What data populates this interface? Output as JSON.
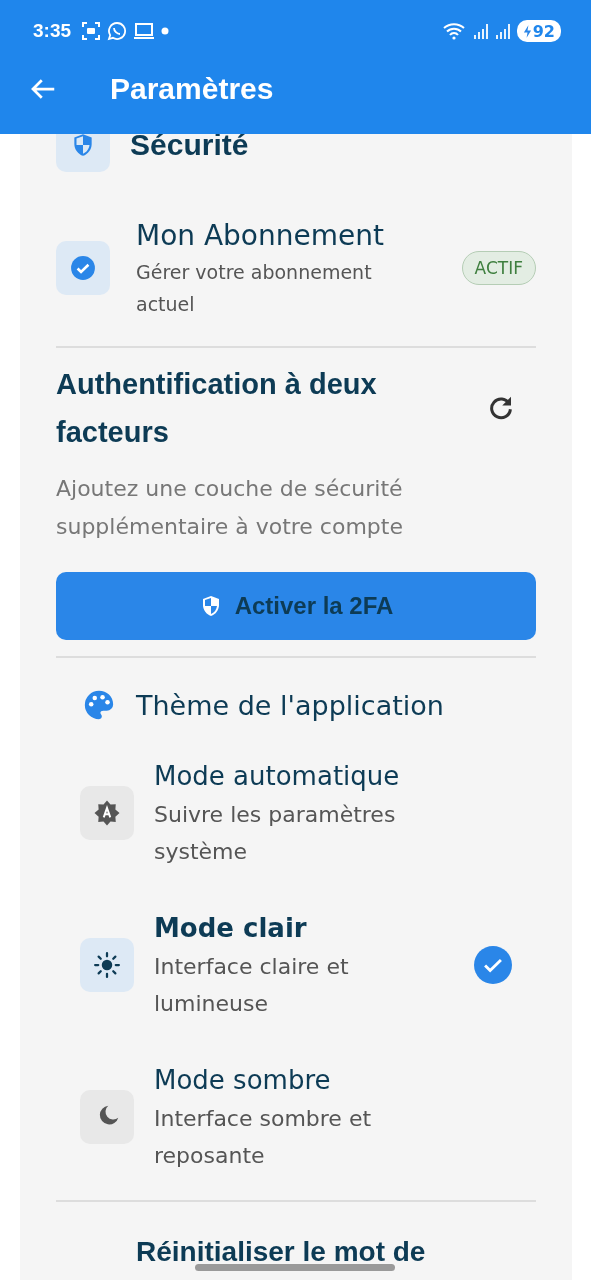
{
  "status_bar": {
    "time": "3:35",
    "battery": "92"
  },
  "app_bar": {
    "title": "Paramètres"
  },
  "security": {
    "title": "Sécurité"
  },
  "subscription": {
    "title": "Mon Abonnement",
    "subtitle": "Gérer votre abonnement actuel",
    "badge": "ACTIF"
  },
  "two_factor": {
    "title": "Authentification à deux facteurs",
    "description": "Ajoutez une couche de sécurité supplémentaire à votre compte",
    "button": "Activer la 2FA"
  },
  "theme": {
    "title": "Thème de l'application",
    "options": [
      {
        "title": "Mode automatique",
        "subtitle": "Suivre les paramètres système",
        "selected": false
      },
      {
        "title": "Mode clair",
        "subtitle": "Interface claire et lumineuse",
        "selected": true
      },
      {
        "title": "Mode sombre",
        "subtitle": "Interface sombre et reposante",
        "selected": false
      }
    ]
  },
  "reset_password": {
    "title": "Réinitialiser le mot de"
  }
}
